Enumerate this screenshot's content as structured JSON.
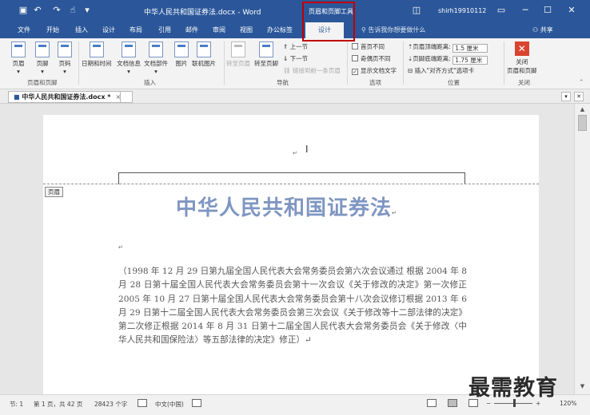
{
  "titlebar": {
    "document_title": "中华人民共和国证券法.docx - Word",
    "context_tool_label": "页眉和页脚工具",
    "username": "shirh19910112",
    "icons": [
      "save-icon",
      "undo-icon",
      "redo-icon",
      "touch-mode-icon",
      "customize-qat-icon",
      "ribbon-display-icon",
      "minimize-icon",
      "maximize-icon",
      "close-icon"
    ]
  },
  "tabs": [
    {
      "label": "文件"
    },
    {
      "label": "开始"
    },
    {
      "label": "插入"
    },
    {
      "label": "设计"
    },
    {
      "label": "布局"
    },
    {
      "label": "引用"
    },
    {
      "label": "邮件"
    },
    {
      "label": "审阅"
    },
    {
      "label": "视图"
    },
    {
      "label": "办公标签"
    },
    {
      "label": "设计",
      "active": true
    }
  ],
  "tell_me": "告诉我你想要做什么",
  "share": "共享",
  "ribbon": {
    "header_footer_group": {
      "label": "页眉和页脚",
      "header": "页眉",
      "footer": "页脚",
      "page_number": "页码"
    },
    "insert_group": {
      "label": "插入",
      "date_time": "日期和时间",
      "doc_info": "文档信息",
      "doc_parts": "文档部件",
      "picture": "图片",
      "online_picture": "联机图片"
    },
    "nav_group": {
      "label": "导航",
      "goto_header": "转至页眉",
      "goto_footer": "转至页脚",
      "prev": "上一节",
      "next": "下一节",
      "link_prev": "链接到前一条页眉"
    },
    "options_group": {
      "label": "选项",
      "different_first": "首页不同",
      "different_odd_even": "奇偶页不同",
      "show_doc_text": "显示文档文字",
      "show_doc_text_checked": true
    },
    "position_group": {
      "label": "位置",
      "header_top_label": "页眉顶端距离:",
      "header_top_value": "1.5 厘米",
      "footer_bottom_label": "页脚底端距离:",
      "footer_bottom_value": "1.75 厘米",
      "insert_align_tab": "插入\"对齐方式\"选项卡"
    },
    "close_group": {
      "label": "关闭",
      "close_line1": "关闭",
      "close_line2": "页眉和页脚"
    }
  },
  "doc_tab": {
    "label": "中华人民共和国证券法.docx *",
    "close": "×"
  },
  "document": {
    "header_tag": "页眉",
    "title": "中华人民共和国证券法",
    "pilcrow": "↵",
    "body_text": "（1998 年 12 月 29 日第九届全国人民代表大会常务委员会第六次会议通过  根据 2004 年 8 月 28 日第十届全国人民代表大会常务委员会第十一次会议《关于修改的决定》第一次修正 2005 年 10 月 27 日第十届全国人民代表大会常务委员会第十八次会议修订根据 2013 年 6 月 29 日第十二届全国人民代表大会常务委员会第三次会议《关于修改等十二部法律的决定》第二次修正根据 2014 年 8 月 31 日第十二届全国人民代表大会常务委员会《关于修改〈中华人民共和国保险法〉等五部法律的决定》修正）↵"
  },
  "statusbar": {
    "section": "节: 1",
    "page": "第 1 页，共 42 页",
    "word_count": "28423 个字",
    "language": "中文(中国)",
    "zoom_minus": "−",
    "zoom_plus": "+",
    "zoom": "120%"
  },
  "watermark": "最需教育"
}
